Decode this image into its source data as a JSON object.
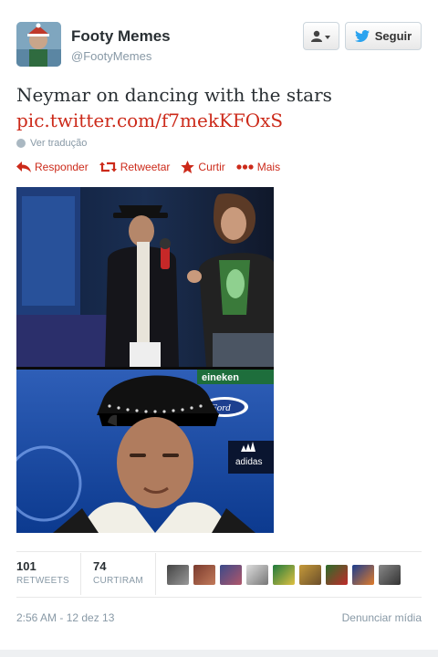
{
  "account": {
    "name": "Footy Memes",
    "handle": "@FootyMemes"
  },
  "header_buttons": {
    "follow_label": "Seguir"
  },
  "tweet": {
    "text": "Neymar on dancing with the stars",
    "link": "pic.twitter.com/f7mekKFOxS",
    "translate_label": "Ver tradução"
  },
  "actions": {
    "reply": "Responder",
    "retweet": "Retweetar",
    "favorite": "Curtir",
    "more": "Mais"
  },
  "media": {
    "top_banner_text": "eineken",
    "ford_text": "Ford",
    "adidas_text": "adidas"
  },
  "stats": {
    "retweets_count": "101",
    "retweets_label": "RETWEETS",
    "likes_count": "74",
    "likes_label": "CURTIRAM"
  },
  "footer": {
    "timestamp": "2:56 AM - 12 dez 13",
    "report": "Denunciar mídia"
  },
  "colors": {
    "accent_red": "#cc2a1a",
    "twitter_blue": "#2aa3ef",
    "muted_text": "#8899a6"
  },
  "icons": [
    "globe-icon",
    "reply-icon",
    "retweet-icon",
    "star-icon",
    "more-dots-icon",
    "user-icon",
    "twitter-bird-icon"
  ]
}
